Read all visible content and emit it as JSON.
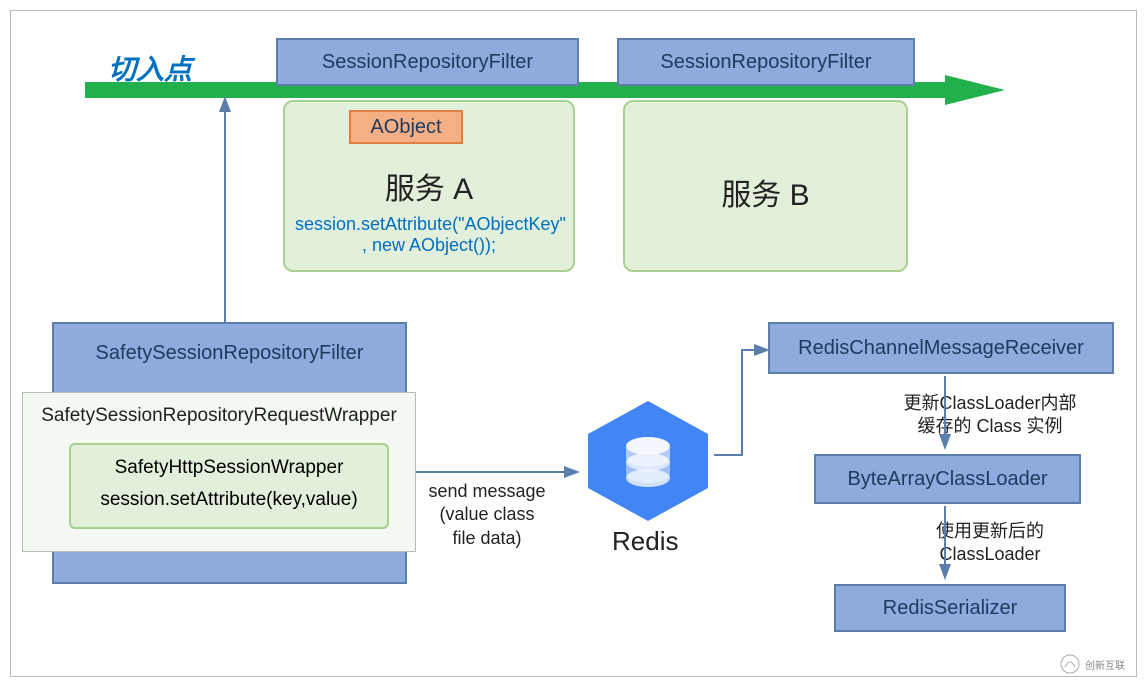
{
  "cutin": "切入点",
  "top": {
    "filter_a": "SessionRepositoryFilter",
    "filter_b": "SessionRepositoryFilter"
  },
  "service_a": {
    "aobject": "AObject",
    "title": "服务 A",
    "code": "session.setAttribute(\"AObjectKey\" , new AObject());"
  },
  "service_b": {
    "title": "服务 B"
  },
  "safety": {
    "filter": "SafetySessionRepositoryFilter",
    "wrapper": "SafetySessionRepositoryRequestWrapper",
    "http_line1": "SafetyHttpSessionWrapper",
    "http_line2": "session.setAttribute(key,value)"
  },
  "send_msg": {
    "l1": "send message",
    "l2": "(value class",
    "l3": "file data)"
  },
  "redis": "Redis",
  "right": {
    "receiver": "RedisChannelMessageReceiver",
    "note1_l1": "更新ClassLoader内部",
    "note1_l2": "缓存的 Class 实例",
    "loader": "ByteArrayClassLoader",
    "note2_l1": "使用更新后的",
    "note2_l2": "ClassLoader",
    "serializer": "RedisSerializer"
  },
  "watermark": "创新互联"
}
